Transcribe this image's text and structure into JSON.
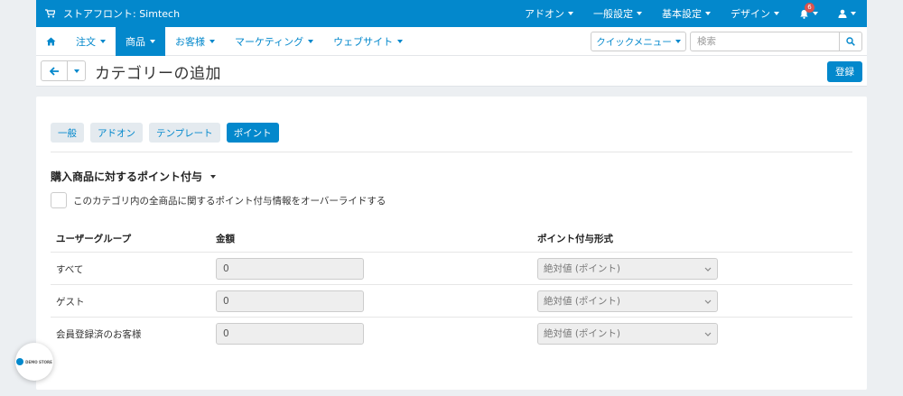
{
  "colors": {
    "primary": "#0388cc",
    "background": "#eceff2",
    "badge": "#d9534f"
  },
  "topbar": {
    "store_icon": "cart-icon",
    "store_name": "ストアフロント: Simtech",
    "menus": [
      "アドオン",
      "一般設定",
      "基本設定",
      "デザイン"
    ],
    "notification_count": "6",
    "bell_icon": "bell-icon",
    "user_icon": "user-icon"
  },
  "nav": {
    "home_icon": "home-icon",
    "tabs": [
      "注文",
      "商品",
      "お客様",
      "マーケティング",
      "ウェブサイト"
    ],
    "active_tab": "商品",
    "quick_menu": "クイックメニュー",
    "search_placeholder": "検索",
    "search_icon": "search-icon"
  },
  "titlebar": {
    "back_icon": "arrow-left-icon",
    "title": "カテゴリーの追加",
    "save_label": "登録"
  },
  "subtabs": [
    "一般",
    "アドオン",
    "テンプレート",
    "ポイント"
  ],
  "active_subtab": "ポイント",
  "section": {
    "title": "購入商品に対するポイント付与",
    "override_label": "このカテゴリ内の全商品に関するポイント付与情報をオーバーライドする"
  },
  "table": {
    "headers": [
      "ユーザーグループ",
      "金額",
      "ポイント付与形式"
    ],
    "rows": [
      {
        "group": "すべて",
        "amount": "0",
        "type": "絶対値 (ポイント)"
      },
      {
        "group": "ゲスト",
        "amount": "0",
        "type": "絶対値 (ポイント)"
      },
      {
        "group": "会員登録済のお客様",
        "amount": "0",
        "type": "絶対値 (ポイント)"
      }
    ]
  },
  "floating_widget": {
    "label": "DEMO STORE"
  }
}
